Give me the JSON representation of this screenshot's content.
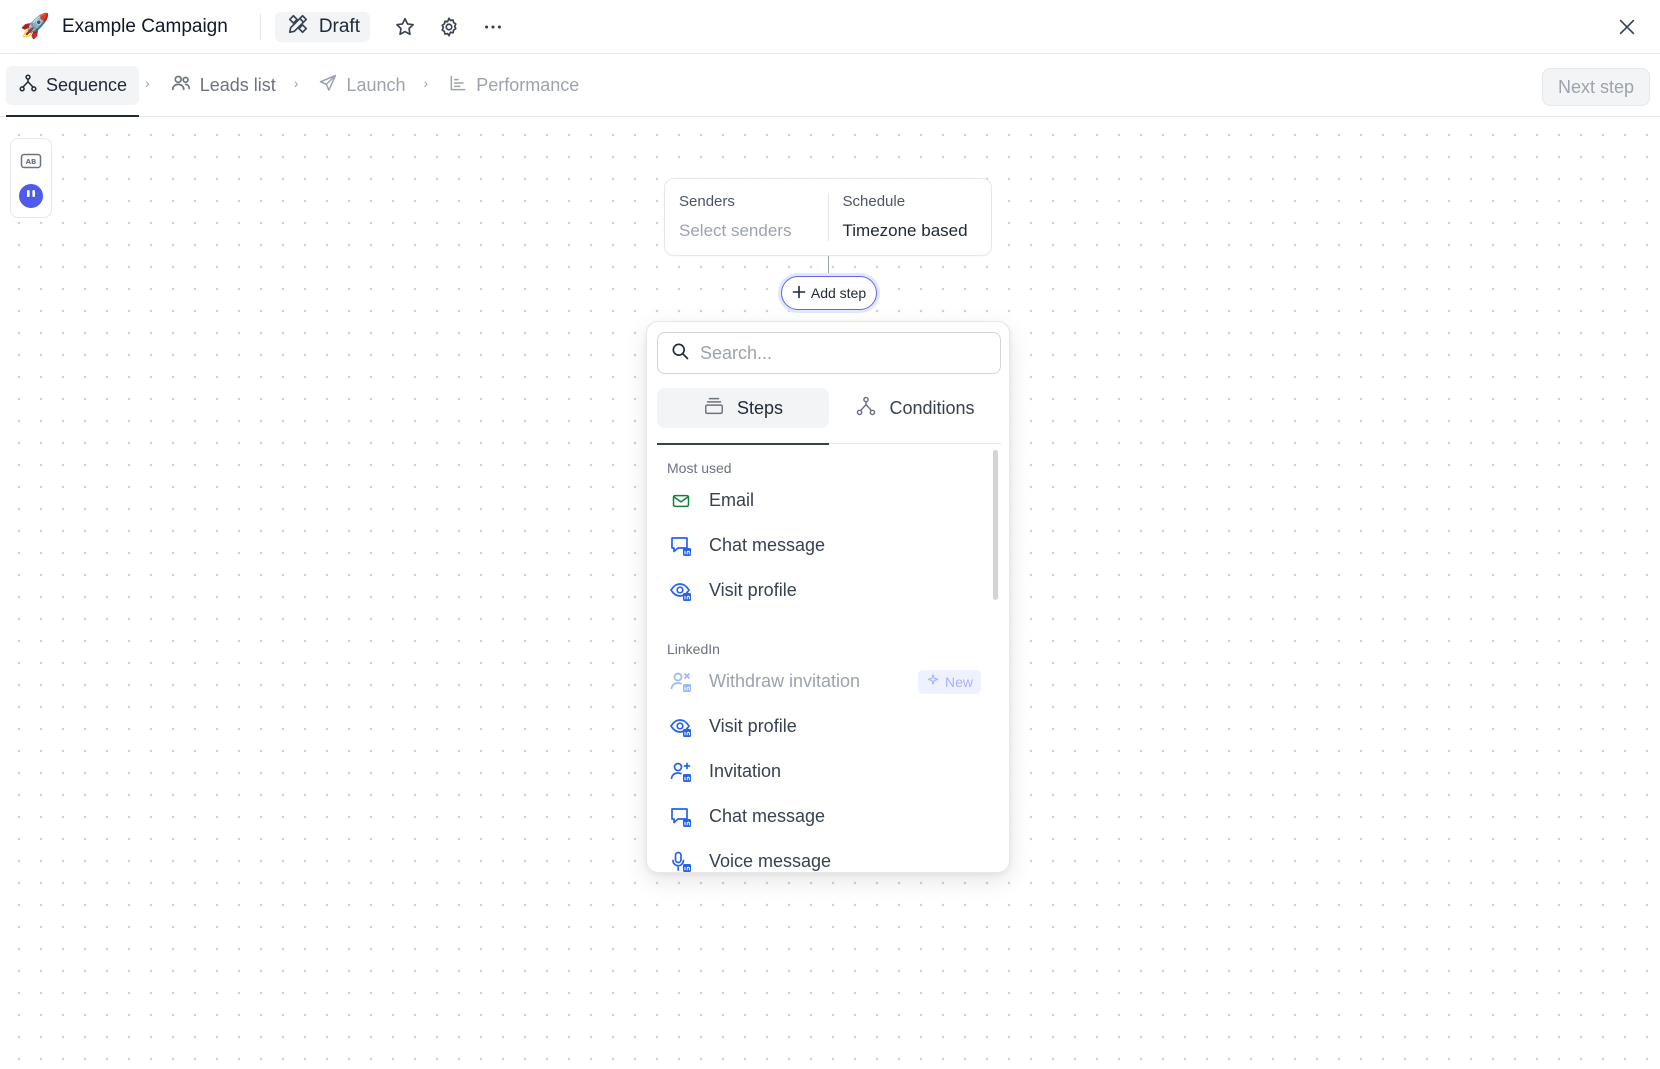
{
  "header": {
    "campaign_icon": "🚀",
    "campaign_title": "Example Campaign",
    "status_label": "Draft"
  },
  "tabs": [
    {
      "label": "Sequence",
      "icon": "flow-icon",
      "active": true
    },
    {
      "label": "Leads list",
      "icon": "users-icon",
      "active": false
    },
    {
      "label": "Launch",
      "icon": "send-icon",
      "active": false
    },
    {
      "label": "Performance",
      "icon": "chart-icon",
      "active": false
    }
  ],
  "next_step_label": "Next step",
  "start_node": {
    "senders_label": "Senders",
    "senders_value": "Select senders",
    "schedule_label": "Schedule",
    "schedule_value": "Timezone based"
  },
  "add_step_label": "Add step",
  "picker": {
    "search_placeholder": "Search...",
    "tab_steps": "Steps",
    "tab_conditions": "Conditions",
    "most_used_label": "Most used",
    "most_used": [
      {
        "label": "Email",
        "icon": "mail-icon"
      },
      {
        "label": "Chat message",
        "icon": "chat-linkedin-icon"
      },
      {
        "label": "Visit profile",
        "icon": "eye-linkedin-icon"
      }
    ],
    "linkedin_label": "LinkedIn",
    "linkedin": [
      {
        "label": "Withdraw invitation",
        "icon": "user-x-linkedin-icon",
        "disabled": true,
        "badge": "New"
      },
      {
        "label": "Visit profile",
        "icon": "eye-linkedin-icon"
      },
      {
        "label": "Invitation",
        "icon": "user-plus-linkedin-icon"
      },
      {
        "label": "Chat message",
        "icon": "chat-linkedin-icon"
      },
      {
        "label": "Voice message",
        "icon": "mic-linkedin-icon"
      }
    ]
  },
  "colors": {
    "accent": "#6366f1",
    "email_green": "#15803d",
    "linkedin_blue": "#2563eb",
    "tab_active_bg": "#f3f4f6"
  }
}
